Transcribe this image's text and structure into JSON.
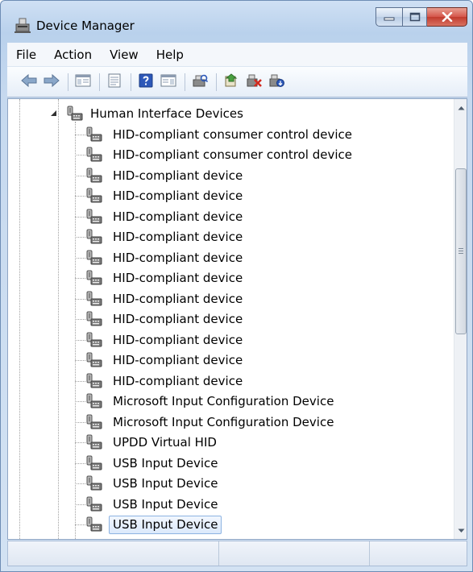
{
  "window": {
    "title": "Device Manager",
    "icons": {
      "app": "device-manager-icon",
      "minimize": "minimize-icon",
      "maximize": "maximize-icon",
      "close": "close-icon"
    }
  },
  "menu": [
    {
      "id": "file",
      "label": "File"
    },
    {
      "id": "action",
      "label": "Action"
    },
    {
      "id": "view",
      "label": "View"
    },
    {
      "id": "help",
      "label": "Help"
    }
  ],
  "toolbar": [
    {
      "id": "back",
      "icon": "back-arrow-icon"
    },
    {
      "id": "forward",
      "icon": "forward-arrow-icon"
    },
    {
      "sep": true
    },
    {
      "id": "show-hide-tree",
      "icon": "console-tree-icon"
    },
    {
      "sep": true
    },
    {
      "id": "properties",
      "icon": "properties-icon"
    },
    {
      "sep": true
    },
    {
      "id": "help",
      "icon": "help-icon"
    },
    {
      "id": "action-pane",
      "icon": "action-pane-icon"
    },
    {
      "sep": true
    },
    {
      "id": "scan-hardware",
      "icon": "scan-hardware-icon"
    },
    {
      "sep": true
    },
    {
      "id": "update-driver",
      "icon": "update-driver-icon"
    },
    {
      "id": "uninstall",
      "icon": "uninstall-icon"
    },
    {
      "id": "disable",
      "icon": "disable-device-icon"
    }
  ],
  "tree": {
    "category": {
      "label": "Human Interface Devices",
      "expanded": true
    },
    "devices": [
      "HID-compliant consumer control device",
      "HID-compliant consumer control device",
      "HID-compliant device",
      "HID-compliant device",
      "HID-compliant device",
      "HID-compliant device",
      "HID-compliant device",
      "HID-compliant device",
      "HID-compliant device",
      "HID-compliant device",
      "HID-compliant device",
      "HID-compliant device",
      "HID-compliant device",
      "Microsoft Input Configuration Device",
      "Microsoft Input Configuration Device",
      "UPDD Virtual HID",
      "USB Input Device",
      "USB Input Device",
      "USB Input Device",
      "USB Input Device"
    ],
    "selected_index": 19
  },
  "statusbar": {
    "panels": [
      "",
      "",
      ""
    ]
  },
  "colors": {
    "title_gradient": "#b9d1ec",
    "selection": "#dbe9fb",
    "selection_border": "#8db3e2",
    "close_button": "#c23b2e"
  }
}
